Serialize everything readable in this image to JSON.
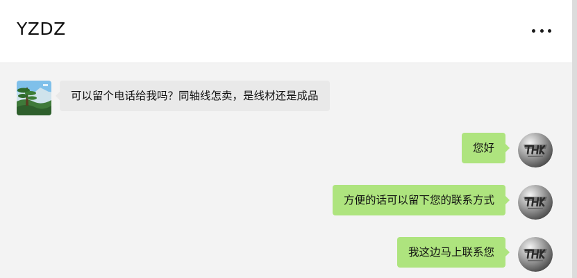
{
  "chat": {
    "title": "YZDZ",
    "more_icon": "more-horizontal-icon",
    "messages": [
      {
        "side": "left",
        "text": "可以留个电话给我吗？同轴线怎卖，是线材还是成品",
        "avatar": "landscape-avatar"
      },
      {
        "side": "right",
        "text": "您好",
        "avatar": "thk-logo-avatar"
      },
      {
        "side": "right",
        "text": "方便的话可以留下您的联系方式",
        "avatar": "thk-logo-avatar"
      },
      {
        "side": "right",
        "text": "我这边马上联系您",
        "avatar": "thk-logo-avatar"
      }
    ]
  },
  "colors": {
    "header_bg": "#ffffff",
    "chat_bg": "#f3f3f3",
    "incoming_bubble": "#e9e9e9",
    "outgoing_bubble": "#aee47e"
  }
}
